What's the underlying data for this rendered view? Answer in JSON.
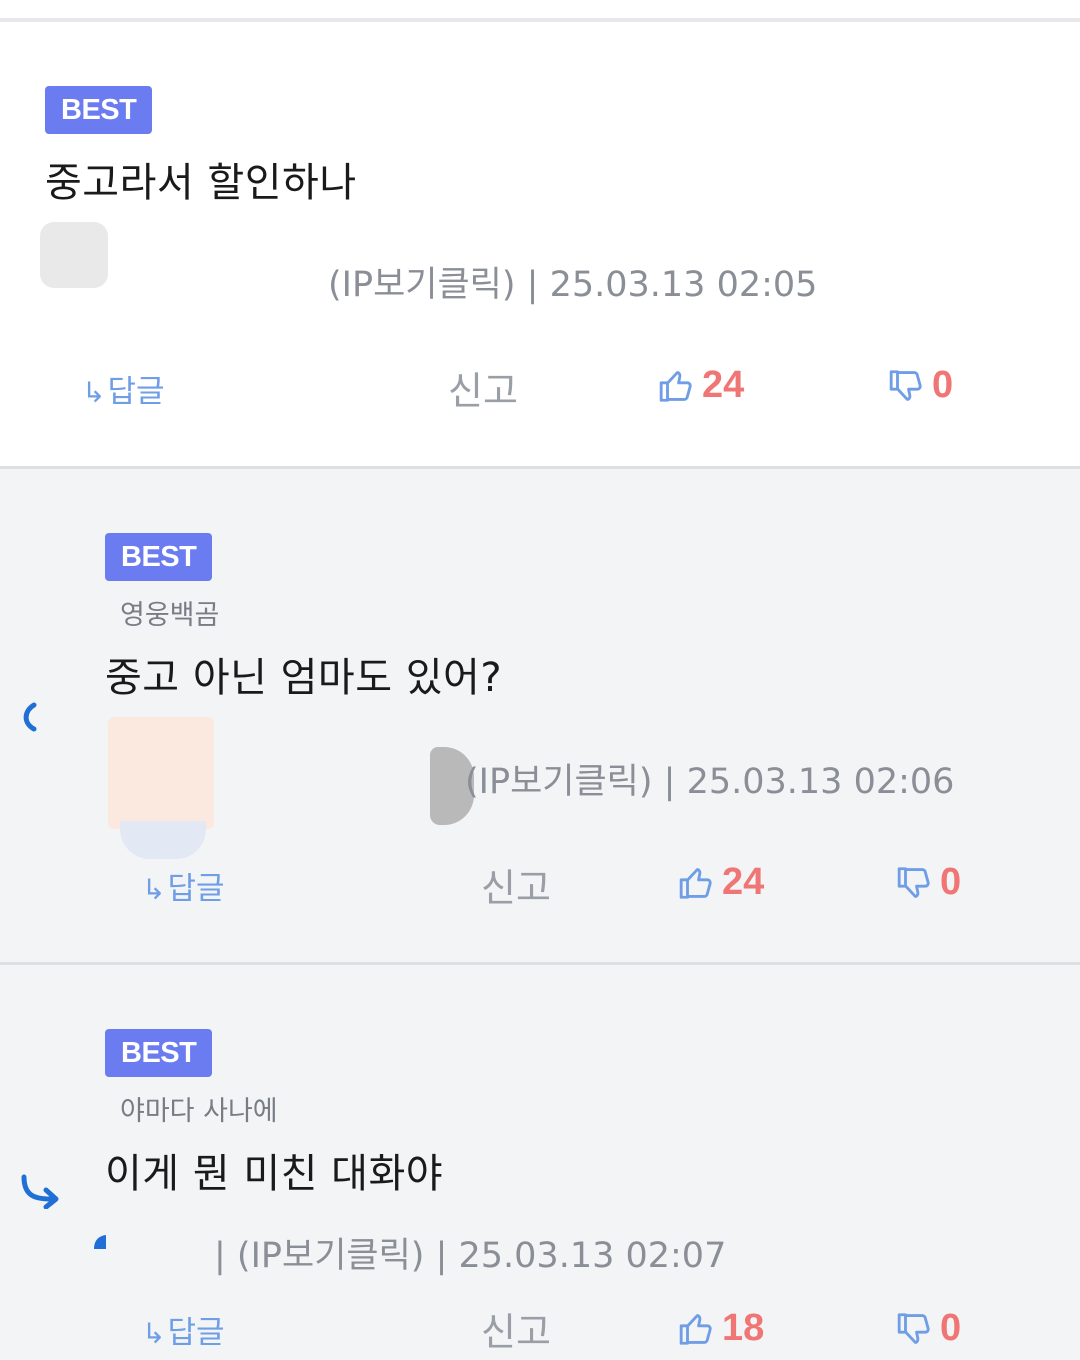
{
  "badge_label": "BEST",
  "comments": [
    {
      "nickname": "",
      "text": "중고라서 할인하나",
      "meta": "(IP보기클릭) | 25.03.13 02:05",
      "reply_label": "답글",
      "report_label": "신고",
      "likes": "24",
      "dislikes": "0"
    },
    {
      "nickname": "영웅백곰",
      "text": "중고 아닌 엄마도 있어?",
      "meta": "(IP보기클릭) | 25.03.13 02:06",
      "reply_label": "답글",
      "report_label": "신고",
      "likes": "24",
      "dislikes": "0"
    },
    {
      "nickname": "야마다 사나에",
      "text": "이게 뭔 미친 대화야",
      "meta": "| (IP보기클릭) | 25.03.13 02:07",
      "reply_label": "답글",
      "report_label": "신고",
      "likes": "18",
      "dislikes": "0"
    }
  ],
  "icons": {
    "reply_arrow": "reply-arrow-icon",
    "thumbs_up": "thumbs-up-icon",
    "thumbs_down": "thumbs-down-icon",
    "nested_reply": "nested-reply-icon"
  },
  "colors": {
    "badge": "#6b7cf0",
    "vote_count": "#f07575",
    "reply_link": "#6f9ee6",
    "thumb_icon": "#6f9ee6",
    "reply_mark": "#1f6fd6"
  }
}
